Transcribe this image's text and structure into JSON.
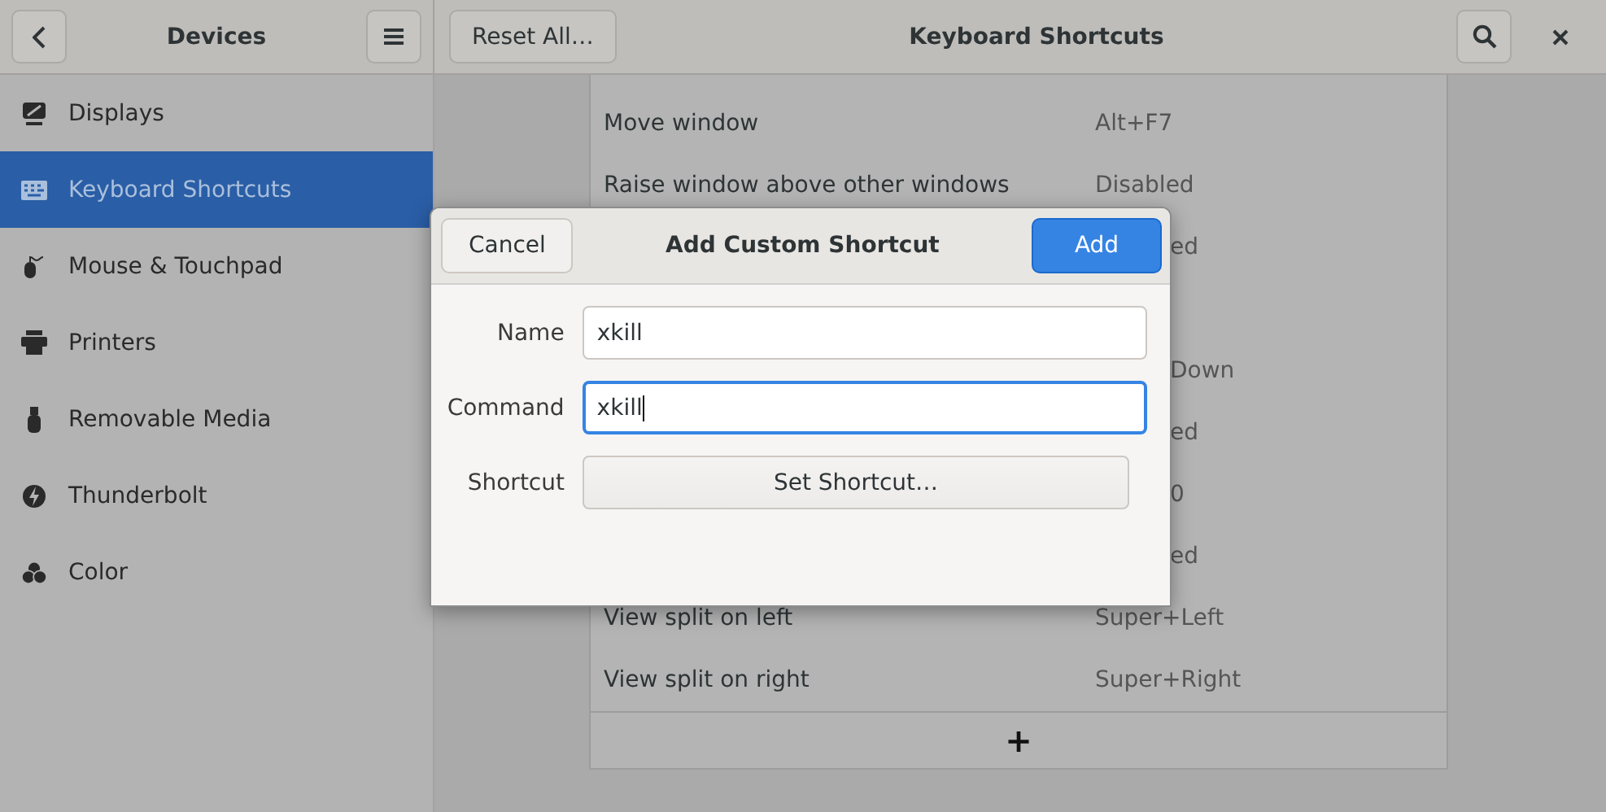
{
  "sidebar": {
    "title": "Devices",
    "items": [
      {
        "label": "Displays",
        "selected": false
      },
      {
        "label": "Keyboard Shortcuts",
        "selected": true
      },
      {
        "label": "Mouse & Touchpad",
        "selected": false
      },
      {
        "label": "Printers",
        "selected": false
      },
      {
        "label": "Removable Media",
        "selected": false
      },
      {
        "label": "Thunderbolt",
        "selected": false
      },
      {
        "label": "Color",
        "selected": false
      }
    ]
  },
  "header": {
    "reset_button": "Reset All…",
    "title": "Keyboard Shortcuts"
  },
  "shortcuts": {
    "rows": [
      {
        "kind": "full",
        "name": "Move window",
        "shortcut": "Alt+F7"
      },
      {
        "kind": "full",
        "name": "Raise window above other windows",
        "shortcut": "Disabled"
      },
      {
        "kind": "covered",
        "shortcut": "ed"
      },
      {
        "kind": "covered"
      },
      {
        "kind": "covered",
        "shortcut": "Down"
      },
      {
        "kind": "covered",
        "shortcut": "ed"
      },
      {
        "kind": "covered",
        "shortcut": "0"
      },
      {
        "kind": "covered",
        "shortcut": "ed"
      },
      {
        "kind": "full",
        "name": "View split on left",
        "shortcut": "Super+Left"
      },
      {
        "kind": "full",
        "name": "View split on right",
        "shortcut": "Super+Right"
      }
    ],
    "add_button": "+"
  },
  "dialog": {
    "title": "Add Custom Shortcut",
    "cancel": "Cancel",
    "confirm": "Add",
    "fields": [
      {
        "label": "Name",
        "value": "xkill",
        "focused": false
      },
      {
        "label": "Command",
        "value": "xkill",
        "focused": true
      }
    ],
    "shortcut": {
      "label": "Shortcut",
      "button": "Set Shortcut…"
    }
  }
}
